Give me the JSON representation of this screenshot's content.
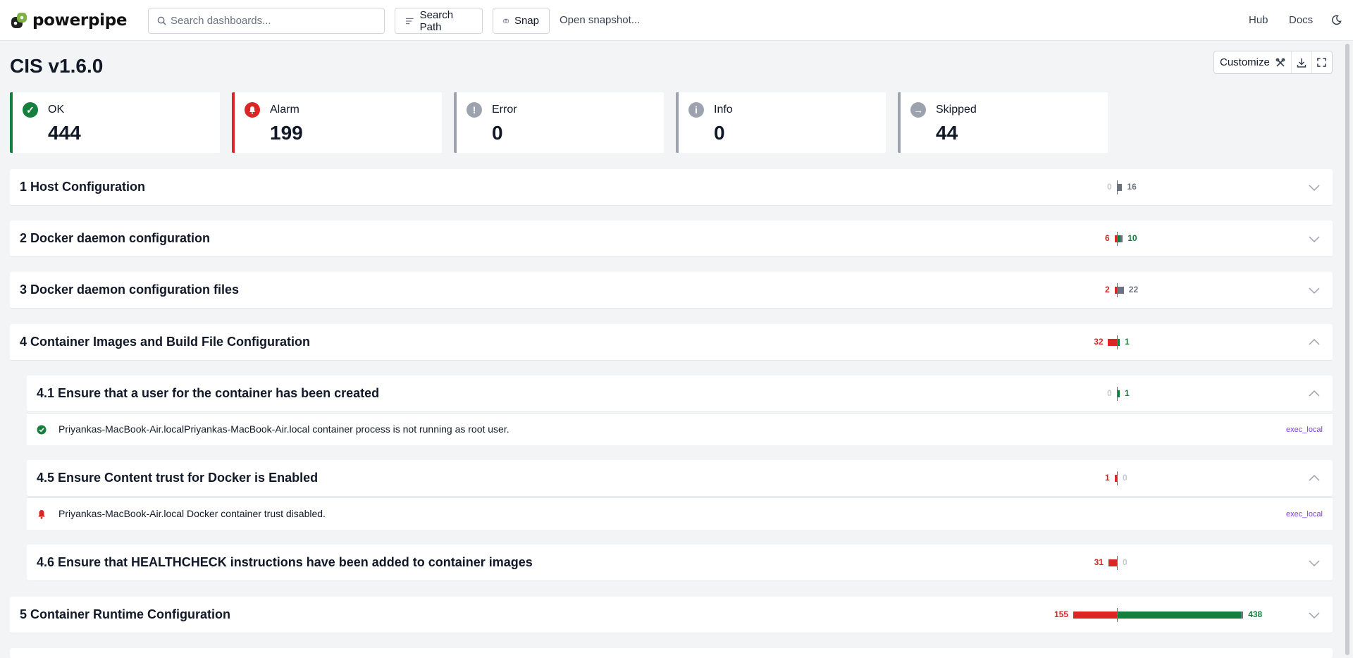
{
  "nav": {
    "brand": "powerpipe",
    "search_placeholder": "Search dashboards...",
    "search_path_label": "Search Path",
    "snap_label": "Snap",
    "open_snapshot_label": "Open snapshot...",
    "hub_label": "Hub",
    "docs_label": "Docs"
  },
  "page": {
    "title": "CIS v1.6.0",
    "customize_label": "Customize"
  },
  "summary": [
    {
      "label": "OK",
      "value": "444",
      "color": "#15803d",
      "icon": "check-circle-icon"
    },
    {
      "label": "Alarm",
      "value": "199",
      "color": "#dc2626",
      "icon": "bell-icon"
    },
    {
      "label": "Error",
      "value": "0",
      "color": "#9ca3af",
      "icon": "exclamation-circle-icon"
    },
    {
      "label": "Info",
      "value": "0",
      "color": "#9ca3af",
      "icon": "info-circle-icon"
    },
    {
      "label": "Skipped",
      "value": "44",
      "color": "#9ca3af",
      "icon": "arrow-right-circle-icon"
    }
  ],
  "groups": [
    {
      "title": "1 Host Configuration",
      "alarm": 0,
      "ok": 0,
      "skip": 16,
      "right_label": "16",
      "expanded": false
    },
    {
      "title": "2 Docker daemon configuration",
      "alarm": 6,
      "ok": 10,
      "skip": 8,
      "right_label": "10",
      "expanded": false
    },
    {
      "title": "3 Docker daemon configuration files",
      "alarm": 2,
      "ok": 0,
      "skip": 22,
      "right_label": "22",
      "expanded": false
    },
    {
      "title": "4 Container Images and Build File Configuration",
      "alarm": 32,
      "ok": 1,
      "skip": 0,
      "right_label": "1",
      "expanded": true
    },
    {
      "title": "4.1 Ensure that a user for the container has been created",
      "alarm": 0,
      "ok": 1,
      "skip": 0,
      "right_label": "1",
      "expanded": true
    },
    {
      "title": "4.5 Ensure Content trust for Docker is Enabled",
      "alarm": 1,
      "ok": 0,
      "skip": 0,
      "right_label": "0",
      "expanded": true
    },
    {
      "title": "4.6 Ensure that HEALTHCHECK instructions have been added to container images",
      "alarm": 31,
      "ok": 0,
      "skip": 0,
      "right_label": "0",
      "expanded": false
    },
    {
      "title": "5 Container Runtime Configuration",
      "alarm": 155,
      "ok": 438,
      "skip": 4,
      "right_label": "438",
      "expanded": false
    }
  ],
  "results": [
    {
      "status": "ok",
      "text": "Priyankas-MacBook-Air.localPriyankas-MacBook-Air.local container process is not running as root user.",
      "tag": "exec_local"
    },
    {
      "status": "alarm",
      "text": "Priyankas-MacBook-Air.local Docker container trust disabled.",
      "tag": "exec_local"
    }
  ],
  "colors": {
    "alarm": "#dc2626",
    "ok": "#15803d",
    "skip": "#6b7280"
  }
}
